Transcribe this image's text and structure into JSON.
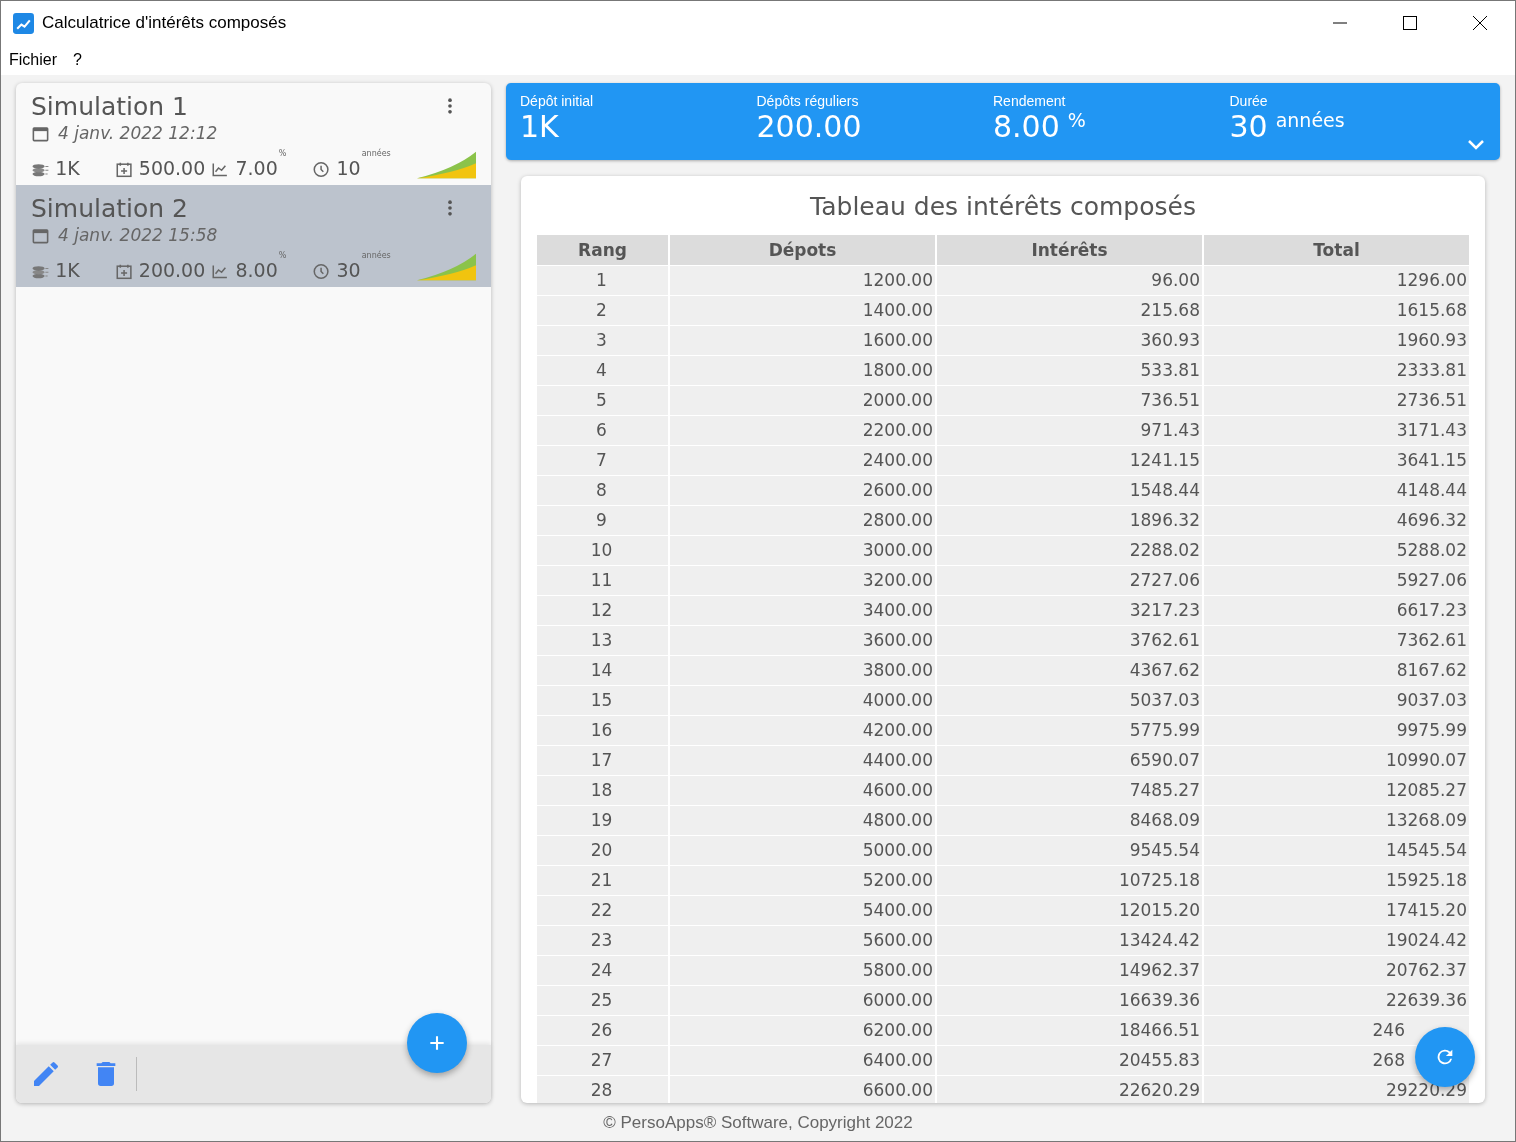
{
  "window": {
    "title": "Calculatrice d'intérêts composés"
  },
  "menu": [
    "Fichier",
    "?"
  ],
  "simulations": [
    {
      "title": "Simulation 1",
      "date": "4 janv. 2022 12:12",
      "initial": "1K",
      "regular": "500.00",
      "rate": "7.00",
      "rate_unit": "%",
      "duration": "10",
      "duration_unit": "années",
      "selected": false
    },
    {
      "title": "Simulation 2",
      "date": "4 janv. 2022 15:58",
      "initial": "1K",
      "regular": "200.00",
      "rate": "8.00",
      "rate_unit": "%",
      "duration": "30",
      "duration_unit": "années",
      "selected": true
    }
  ],
  "summary": [
    {
      "label": "Dépôt initial",
      "value": "1K"
    },
    {
      "label": "Dépôts réguliers",
      "value": "200.00"
    },
    {
      "label": "Rendement",
      "value": "8.00",
      "unit": "%"
    },
    {
      "label": "Durée",
      "value": "30",
      "unit": "années"
    }
  ],
  "table": {
    "title": "Tableau des intérêts composés",
    "columns": [
      "Rang",
      "Dépots",
      "Intérêts",
      "Total"
    ],
    "rows": [
      {
        "cells": [
          "1",
          "1200.00",
          "96.00",
          "1296.00"
        ]
      },
      {
        "cells": [
          "2",
          "1400.00",
          "215.68",
          "1615.68"
        ]
      },
      {
        "cells": [
          "3",
          "1600.00",
          "360.93",
          "1960.93"
        ]
      },
      {
        "cells": [
          "4",
          "1800.00",
          "533.81",
          "2333.81"
        ]
      },
      {
        "cells": [
          "5",
          "2000.00",
          "736.51",
          "2736.51"
        ]
      },
      {
        "cells": [
          "6",
          "2200.00",
          "971.43",
          "3171.43"
        ]
      },
      {
        "cells": [
          "7",
          "2400.00",
          "1241.15",
          "3641.15"
        ]
      },
      {
        "cells": [
          "8",
          "2600.00",
          "1548.44",
          "4148.44"
        ]
      },
      {
        "cells": [
          "9",
          "2800.00",
          "1896.32",
          "4696.32"
        ]
      },
      {
        "cells": [
          "10",
          "3000.00",
          "2288.02",
          "5288.02"
        ]
      },
      {
        "cells": [
          "11",
          "3200.00",
          "2727.06",
          "5927.06"
        ]
      },
      {
        "cells": [
          "12",
          "3400.00",
          "3217.23",
          "6617.23"
        ]
      },
      {
        "cells": [
          "13",
          "3600.00",
          "3762.61",
          "7362.61"
        ]
      },
      {
        "cells": [
          "14",
          "3800.00",
          "4367.62",
          "8167.62"
        ]
      },
      {
        "cells": [
          "15",
          "4000.00",
          "5037.03",
          "9037.03"
        ]
      },
      {
        "cells": [
          "16",
          "4200.00",
          "5775.99",
          "9975.99"
        ]
      },
      {
        "cells": [
          "17",
          "4400.00",
          "6590.07",
          "10990.07"
        ]
      },
      {
        "cells": [
          "18",
          "4600.00",
          "7485.27",
          "12085.27"
        ]
      },
      {
        "cells": [
          "19",
          "4800.00",
          "8468.09",
          "13268.09"
        ]
      },
      {
        "cells": [
          "20",
          "5000.00",
          "9545.54",
          "14545.54"
        ]
      },
      {
        "cells": [
          "21",
          "5200.00",
          "10725.18",
          "15925.18"
        ]
      },
      {
        "cells": [
          "22",
          "5400.00",
          "12015.20",
          "17415.20"
        ]
      },
      {
        "cells": [
          "23",
          "5600.00",
          "13424.42",
          "19024.42"
        ]
      },
      {
        "cells": [
          "24",
          "5800.00",
          "14962.37",
          "20762.37"
        ]
      },
      {
        "cells": [
          "25",
          "6000.00",
          "16639.36",
          "22639.36"
        ]
      },
      {
        "cells": [
          "26",
          "6200.00",
          "18466.51",
          "246"
        ],
        "covered": true
      },
      {
        "cells": [
          "27",
          "6400.00",
          "20455.83",
          "268"
        ],
        "covered": true
      },
      {
        "cells": [
          "28",
          "6600.00",
          "22620.29",
          "29220.29"
        ]
      }
    ]
  },
  "footer": "© PersoApps® Software, Copyright 2022"
}
